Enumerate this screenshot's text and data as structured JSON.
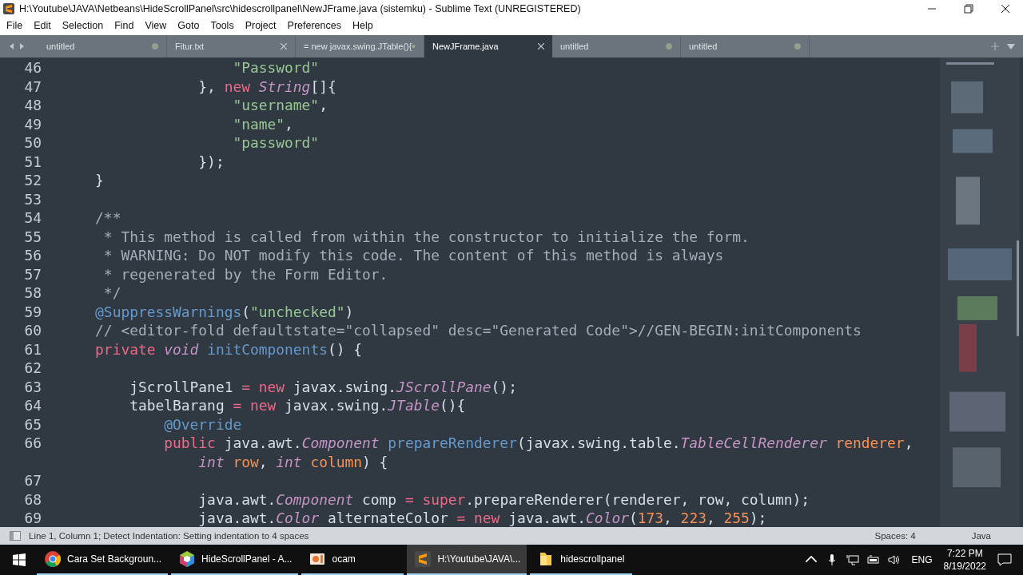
{
  "window": {
    "title": "H:\\Youtube\\JAVA\\Netbeans\\HideScrollPanel\\src\\hidescrollpanel\\NewJFrame.java (sistemku) - Sublime Text (UNREGISTERED)"
  },
  "menu": [
    "File",
    "Edit",
    "Selection",
    "Find",
    "View",
    "Goto",
    "Tools",
    "Project",
    "Preferences",
    "Help"
  ],
  "tabs": [
    {
      "label": "untitled",
      "selected": false,
      "modified": true
    },
    {
      "label": "Fitur.txt",
      "selected": false,
      "modified": false
    },
    {
      "label": "= new javax.swing.JTable(){",
      "selected": false,
      "modified": true
    },
    {
      "label": "NewJFrame.java",
      "selected": true,
      "modified": false
    },
    {
      "label": "untitled",
      "selected": false,
      "modified": true
    },
    {
      "label": "untitled",
      "selected": false,
      "modified": true
    }
  ],
  "editor": {
    "lines": [
      {
        "number": "46",
        "tokens": [
          {
            "text": "                    \"Password\"",
            "kind": "string"
          }
        ]
      },
      {
        "number": "47",
        "tokens": [
          {
            "text": "                }, ",
            "kind": "plain"
          },
          {
            "text": "new ",
            "kind": "keyword"
          },
          {
            "text": "String",
            "kind": "type"
          },
          {
            "text": "[]{",
            "kind": "plain"
          }
        ]
      },
      {
        "number": "48",
        "tokens": [
          {
            "text": "                    \"username\"",
            "kind": "string"
          },
          {
            "text": ",",
            "kind": "plain"
          }
        ]
      },
      {
        "number": "49",
        "tokens": [
          {
            "text": "                    \"name\"",
            "kind": "string"
          },
          {
            "text": ",",
            "kind": "plain"
          }
        ]
      },
      {
        "number": "50",
        "tokens": [
          {
            "text": "                    \"password\"",
            "kind": "string"
          }
        ]
      },
      {
        "number": "51",
        "tokens": [
          {
            "text": "                });",
            "kind": "plain"
          }
        ]
      },
      {
        "number": "52",
        "tokens": [
          {
            "text": "    }",
            "kind": "plain"
          }
        ]
      },
      {
        "number": "53"
      },
      {
        "number": "54",
        "tokens": [
          {
            "text": "    /**",
            "kind": "comment"
          }
        ]
      },
      {
        "number": "55",
        "tokens": [
          {
            "text": "     * This method is called from within the constructor to initialize the form.",
            "kind": "comment"
          }
        ]
      },
      {
        "number": "56",
        "tokens": [
          {
            "text": "     * WARNING: Do NOT modify this code. The content of this method is always",
            "kind": "comment"
          }
        ]
      },
      {
        "number": "57",
        "tokens": [
          {
            "text": "     * regenerated by the Form Editor.",
            "kind": "comment"
          }
        ]
      },
      {
        "number": "58",
        "tokens": [
          {
            "text": "     */",
            "kind": "comment"
          }
        ]
      },
      {
        "number": "59",
        "tokens": [
          {
            "text": "    @SuppressWarnings",
            "kind": "annotation"
          },
          {
            "text": "(",
            "kind": "plain"
          },
          {
            "text": "\"unchecked\"",
            "kind": "string"
          },
          {
            "text": ")",
            "kind": "plain"
          }
        ]
      },
      {
        "number": "60",
        "tokens": [
          {
            "text": "    // <editor-fold defaultstate=\"collapsed\" desc=\"Generated Code\">//GEN-BEGIN:initComponents",
            "kind": "comment"
          }
        ]
      },
      {
        "number": "61",
        "tokens": [
          {
            "text": "    private ",
            "kind": "keyword"
          },
          {
            "text": "void ",
            "kind": "storage"
          },
          {
            "text": "initComponents",
            "kind": "function"
          },
          {
            "text": "() {",
            "kind": "plain"
          }
        ]
      },
      {
        "number": "62"
      },
      {
        "number": "63",
        "tokens": [
          {
            "text": "        jScrollPane1 ",
            "kind": "plain"
          },
          {
            "text": "= ",
            "kind": "keyword"
          },
          {
            "text": "new",
            "kind": "keyword"
          },
          {
            "text": " javax.swing.",
            "kind": "plain"
          },
          {
            "text": "JScrollPane",
            "kind": "type"
          },
          {
            "text": "();",
            "kind": "plain"
          }
        ]
      },
      {
        "number": "64",
        "tokens": [
          {
            "text": "        tabelBarang ",
            "kind": "plain"
          },
          {
            "text": "= ",
            "kind": "keyword"
          },
          {
            "text": "new",
            "kind": "keyword"
          },
          {
            "text": " javax.swing.",
            "kind": "plain"
          },
          {
            "text": "JTable",
            "kind": "type"
          },
          {
            "text": "(){",
            "kind": "plain"
          }
        ]
      },
      {
        "number": "65",
        "tokens": [
          {
            "text": "            @Override",
            "kind": "annotation"
          }
        ]
      },
      {
        "number": "66",
        "tokens": [
          {
            "text": "            public",
            "kind": "keyword"
          },
          {
            "text": " java.awt.",
            "kind": "plain"
          },
          {
            "text": "Component ",
            "kind": "type"
          },
          {
            "text": "prepareRenderer",
            "kind": "function"
          },
          {
            "text": "(javax.swing.table.",
            "kind": "plain"
          },
          {
            "text": "TableCellRenderer ",
            "kind": "type"
          },
          {
            "text": "renderer",
            "kind": "parameter"
          },
          {
            "text": ",",
            "kind": "plain"
          }
        ],
        "continuation": [
          {
            "text": "                int ",
            "kind": "storage"
          },
          {
            "text": "row",
            "kind": "parameter"
          },
          {
            "text": ", ",
            "kind": "plain"
          },
          {
            "text": "int ",
            "kind": "storage"
          },
          {
            "text": "column",
            "kind": "parameter"
          },
          {
            "text": ") {",
            "kind": "plain"
          }
        ]
      },
      {
        "number": "67"
      },
      {
        "number": "68",
        "tokens": [
          {
            "text": "                java.awt.",
            "kind": "plain"
          },
          {
            "text": "Component",
            "kind": "type"
          },
          {
            "text": " comp ",
            "kind": "plain"
          },
          {
            "text": "= ",
            "kind": "keyword"
          },
          {
            "text": "super",
            "kind": "keyword"
          },
          {
            "text": ".prepareRenderer(renderer, row, column);",
            "kind": "plain"
          }
        ]
      },
      {
        "number": "69",
        "tokens": [
          {
            "text": "                java.awt.",
            "kind": "plain"
          },
          {
            "text": "Color",
            "kind": "type"
          },
          {
            "text": " alternateColor ",
            "kind": "plain"
          },
          {
            "text": "= ",
            "kind": "keyword"
          },
          {
            "text": "new",
            "kind": "keyword"
          },
          {
            "text": " java.awt.",
            "kind": "plain"
          },
          {
            "text": "Color",
            "kind": "type"
          },
          {
            "text": "(",
            "kind": "plain"
          },
          {
            "text": "173",
            "kind": "number"
          },
          {
            "text": ", ",
            "kind": "plain"
          },
          {
            "text": "223",
            "kind": "number"
          },
          {
            "text": ", ",
            "kind": "plain"
          },
          {
            "text": "255",
            "kind": "number"
          },
          {
            "text": ");",
            "kind": "plain"
          }
        ]
      }
    ]
  },
  "status_bar": {
    "message": "Line 1, Column 1; Detect Indentation: Setting indentation to 4 spaces",
    "indentation": "Spaces: 4",
    "syntax": "Java"
  },
  "taskbar": {
    "apps": [
      {
        "kind": "chrome",
        "label": "Cara Set Backgroun...",
        "selected": false
      },
      {
        "kind": "netbeans",
        "label": "HideScrollPanel - A...",
        "selected": false
      },
      {
        "kind": "ocam",
        "label": "ocam",
        "selected": false
      },
      {
        "kind": "sublime",
        "label": "H:\\Youtube\\JAVA\\...",
        "selected": true
      },
      {
        "kind": "folder",
        "label": "hidescrollpanel",
        "selected": false
      }
    ],
    "language": "ENG",
    "time": "7:22 PM",
    "date": "8/19/2022"
  }
}
